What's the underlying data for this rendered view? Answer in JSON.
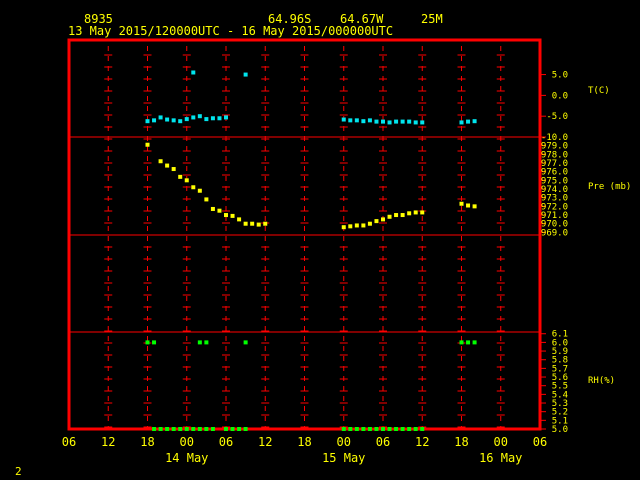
{
  "header": {
    "station": "8935",
    "lat": "64.96S",
    "lon": "64.67W",
    "elev": "25M",
    "period": "13 May 2015/120000UTC - 16 May 2015/000000UTC"
  },
  "footer": {
    "page_num": "2"
  },
  "colors": {
    "frame": "#ff0000",
    "ticks": "#ff0000",
    "labels": "#ffff00",
    "temp": "#00e5ee",
    "pres": "#ffff00",
    "rh": "#00ff00"
  },
  "chart_data": [
    {
      "type": "scatter",
      "name": "T(C)",
      "ylabel": "T(C)",
      "yticks": [
        "5.0",
        "0.0",
        "-5.0",
        "-10.0"
      ],
      "ytick_values": [
        5,
        0,
        -5,
        -10
      ],
      "ylim": [
        -10,
        8.5
      ],
      "series": [
        {
          "color": "#00e5ee",
          "points": [
            [
              0.0,
              -6.2
            ],
            [
              1.0,
              -6.0
            ],
            [
              2.0,
              -5.3
            ],
            [
              3.0,
              -5.8
            ],
            [
              4.0,
              -6.0
            ],
            [
              5.0,
              -6.2
            ],
            [
              6.0,
              -5.7
            ],
            [
              7.0,
              -5.3
            ],
            [
              8.0,
              -5.0
            ],
            [
              9.0,
              -5.7
            ],
            [
              10.0,
              -5.5
            ],
            [
              11.0,
              -5.5
            ],
            [
              12.0,
              -5.3
            ],
            [
              7.0,
              5.5
            ],
            [
              15.0,
              5.0
            ],
            [
              30.0,
              -5.8
            ],
            [
              31.0,
              -6.0
            ],
            [
              32.0,
              -6.0
            ],
            [
              33.0,
              -6.2
            ],
            [
              34.0,
              -6.0
            ],
            [
              35.0,
              -6.3
            ],
            [
              36.0,
              -6.3
            ],
            [
              37.0,
              -6.5
            ],
            [
              38.0,
              -6.3
            ],
            [
              39.0,
              -6.3
            ],
            [
              40.0,
              -6.3
            ],
            [
              41.0,
              -6.5
            ],
            [
              42.0,
              -6.5
            ],
            [
              48.0,
              -6.5
            ],
            [
              49.0,
              -6.3
            ],
            [
              50.0,
              -6.2
            ]
          ]
        }
      ]
    },
    {
      "type": "scatter",
      "name": "Pre (mb)",
      "ylabel": "Pre (mb)",
      "yticks": [
        "979.0",
        "978.0",
        "977.0",
        "976.0",
        "975.0",
        "974.0",
        "973.0",
        "972.0",
        "971.0",
        "970.0",
        "969.0"
      ],
      "ytick_values": [
        979,
        978,
        977,
        976,
        975,
        974,
        973,
        972,
        971,
        970,
        969
      ],
      "ylim": [
        968.7,
        979.3
      ],
      "series": [
        {
          "color": "#ffff00",
          "points": [
            [
              0.0,
              979.1
            ],
            [
              2.0,
              977.2
            ],
            [
              3.0,
              976.7
            ],
            [
              4.0,
              976.3
            ],
            [
              5.0,
              975.4
            ],
            [
              6.0,
              975.0
            ],
            [
              7.0,
              974.2
            ],
            [
              8.0,
              973.8
            ],
            [
              9.0,
              972.8
            ],
            [
              10.0,
              971.7
            ],
            [
              11.0,
              971.5
            ],
            [
              12.0,
              971.0
            ],
            [
              13.0,
              970.9
            ],
            [
              14.0,
              970.5
            ],
            [
              15.0,
              970.0
            ],
            [
              16.0,
              970.0
            ],
            [
              17.0,
              969.9
            ],
            [
              18.0,
              970.0
            ],
            [
              30.0,
              969.6
            ],
            [
              31.0,
              969.7
            ],
            [
              32.0,
              969.8
            ],
            [
              33.0,
              969.8
            ],
            [
              34.0,
              970.0
            ],
            [
              35.0,
              970.3
            ],
            [
              36.0,
              970.5
            ],
            [
              37.0,
              970.8
            ],
            [
              38.0,
              971.0
            ],
            [
              39.0,
              971.0
            ],
            [
              40.0,
              971.2
            ],
            [
              41.0,
              971.3
            ],
            [
              42.0,
              971.3
            ],
            [
              48.0,
              972.3
            ],
            [
              49.0,
              972.1
            ],
            [
              50.0,
              972.0
            ]
          ]
        }
      ]
    },
    {
      "type": "scatter",
      "name": "RH(%)",
      "ylabel": "RH(%)",
      "yticks": [
        "6.1",
        "6.0",
        "5.9",
        "5.8",
        "5.7",
        "5.6",
        "5.5",
        "5.4",
        "5.3",
        "5.2",
        "5.1",
        "5.0"
      ],
      "ytick_values": [
        6.1,
        6.0,
        5.9,
        5.8,
        5.7,
        5.6,
        5.5,
        5.4,
        5.3,
        5.2,
        5.1,
        5.0
      ],
      "ylim": [
        5.0,
        6.12
      ],
      "series": [
        {
          "color": "#00ff00",
          "points": [
            [
              0.0,
              6.0
            ],
            [
              1.0,
              6.0
            ],
            [
              8.0,
              6.0
            ],
            [
              9.0,
              6.0
            ],
            [
              15.0,
              6.0
            ],
            [
              1.0,
              5.0
            ],
            [
              2.0,
              5.0
            ],
            [
              3.0,
              5.0
            ],
            [
              4.0,
              5.0
            ],
            [
              5.0,
              5.0
            ],
            [
              6.0,
              5.0
            ],
            [
              7.0,
              5.0
            ],
            [
              8.0,
              5.0
            ],
            [
              9.0,
              5.0
            ],
            [
              10.0,
              5.0
            ],
            [
              12.0,
              5.0
            ],
            [
              13.0,
              5.0
            ],
            [
              14.0,
              5.0
            ],
            [
              15.0,
              5.0
            ],
            [
              30.0,
              5.0
            ],
            [
              31.0,
              5.0
            ],
            [
              32.0,
              5.0
            ],
            [
              33.0,
              5.0
            ],
            [
              34.0,
              5.0
            ],
            [
              35.0,
              5.0
            ],
            [
              36.0,
              5.0
            ],
            [
              37.0,
              5.0
            ],
            [
              38.0,
              5.0
            ],
            [
              39.0,
              5.0
            ],
            [
              40.0,
              5.0
            ],
            [
              41.0,
              5.0
            ],
            [
              42.0,
              5.0
            ],
            [
              48.0,
              6.0
            ],
            [
              49.0,
              6.0
            ],
            [
              50.0,
              6.0
            ]
          ]
        }
      ]
    }
  ],
  "xaxis": {
    "tick_labels": [
      "06",
      "12",
      "18",
      "00",
      "06",
      "12",
      "18",
      "00",
      "06",
      "12",
      "18",
      "00",
      "06"
    ],
    "date_labels": [
      {
        "text": "14 May",
        "at": 3
      },
      {
        "text": "15 May",
        "at": 7
      },
      {
        "text": "16 May",
        "at": 11
      }
    ]
  }
}
